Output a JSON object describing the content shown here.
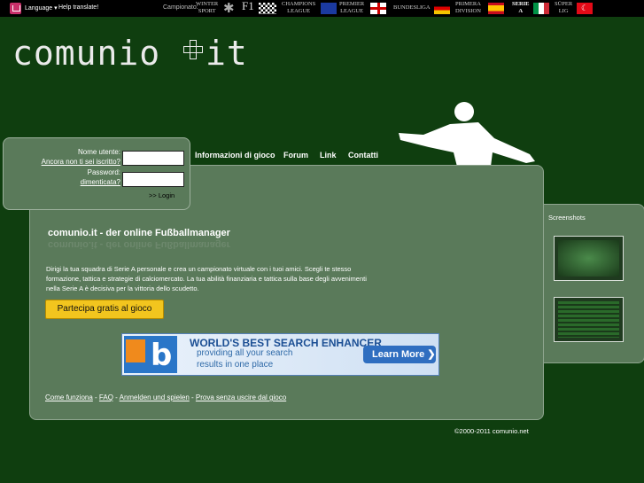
{
  "topbar": {
    "language": "Language",
    "help_translate": "Help translate!",
    "campionato": "Campionato:",
    "competitions": [
      {
        "label": "WINTER\nSPORT",
        "icon": "snowflake-icon"
      },
      {
        "label": "F1",
        "icon": "checkered-flag-icon"
      },
      {
        "label": "CHAMPIONS\nLEAGUE",
        "icon": "eu-flag-icon"
      },
      {
        "label": "PREMIER\nLEAGUE",
        "icon": "england-flag-icon"
      },
      {
        "label": "BUNDESLIGA",
        "icon": "germany-flag-icon"
      },
      {
        "label": "PRIMERA\nDIVISION",
        "icon": "spain-flag-icon"
      },
      {
        "label": "SERIE\nA",
        "icon": "italy-flag-icon"
      },
      {
        "label": "SÜPER\nLIG",
        "icon": "turkey-flag-icon"
      }
    ]
  },
  "logo": {
    "text": "comunio",
    "suffix": "it"
  },
  "login": {
    "username_label": "Nome utente:",
    "register_link": "Ancora non ti sei iscritto?",
    "password_label": "Password:",
    "forgot_link": "dimenticata?",
    "login_button": ">> Login"
  },
  "nav": {
    "items": [
      "Informazioni di gioco",
      "Forum",
      "Link",
      "Contatti"
    ]
  },
  "main": {
    "headline": "comunio.it - der online Fußballmanager",
    "description": "Dirigi la tua squadra di Serie A personale e crea un campionato virtuale con i tuoi amici. Scegli te stesso formazione, tattica e strategie di calciomercato. La tua abilità finanziaria e tattica sulla base degli avvenimenti nella Serie A è decisiva per la vittoria dello scudetto.",
    "cta": "Partecipa gratis al gioco"
  },
  "banner": {
    "headline": "WORLD'S BEST SEARCH ENHANCER",
    "line1": "providing all your search",
    "line2": "results in one place",
    "button": "Learn More",
    "button_arrow": "❯"
  },
  "footer": {
    "links": [
      "Come funziona",
      "FAQ",
      "Anmelden und spielen",
      "Prova senza uscire dal gioco"
    ],
    "separator": " - ",
    "copyright": "©2000-2011 comunio.net"
  },
  "side": {
    "title": "Screenshots"
  },
  "colors": {
    "background": "#0f3e0f",
    "panel": "#5a7a5a",
    "cta": "#f2c51e"
  }
}
